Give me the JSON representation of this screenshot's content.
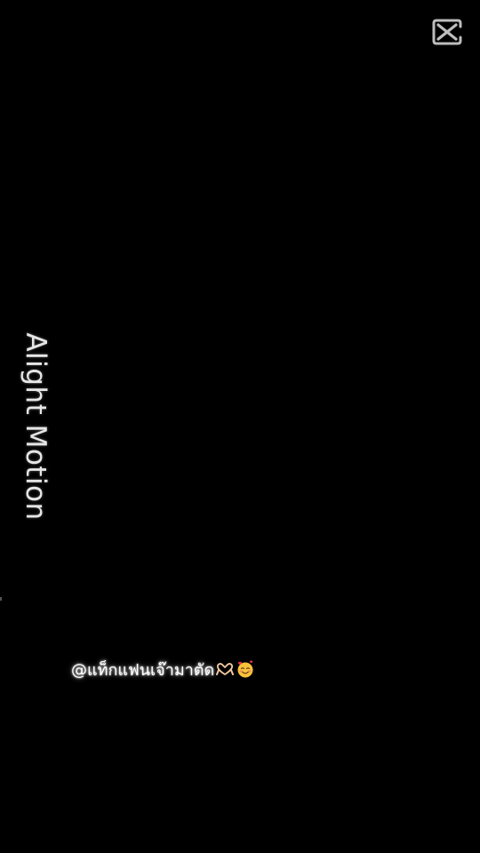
{
  "app": {
    "logo_icon": "capcut-logo-icon"
  },
  "overlay": {
    "watermark_text": "Alight Motion",
    "caption_text": "@แท็กแฟนเจ๊ามาตัด",
    "caption_emojis": [
      "heart-hands-icon",
      "smiling-face-with-hearts-icon"
    ]
  },
  "colors": {
    "background": "#000000",
    "watermark": "#e6e6e6",
    "caption": "#ffffff",
    "logo": "#bdbdbd"
  }
}
